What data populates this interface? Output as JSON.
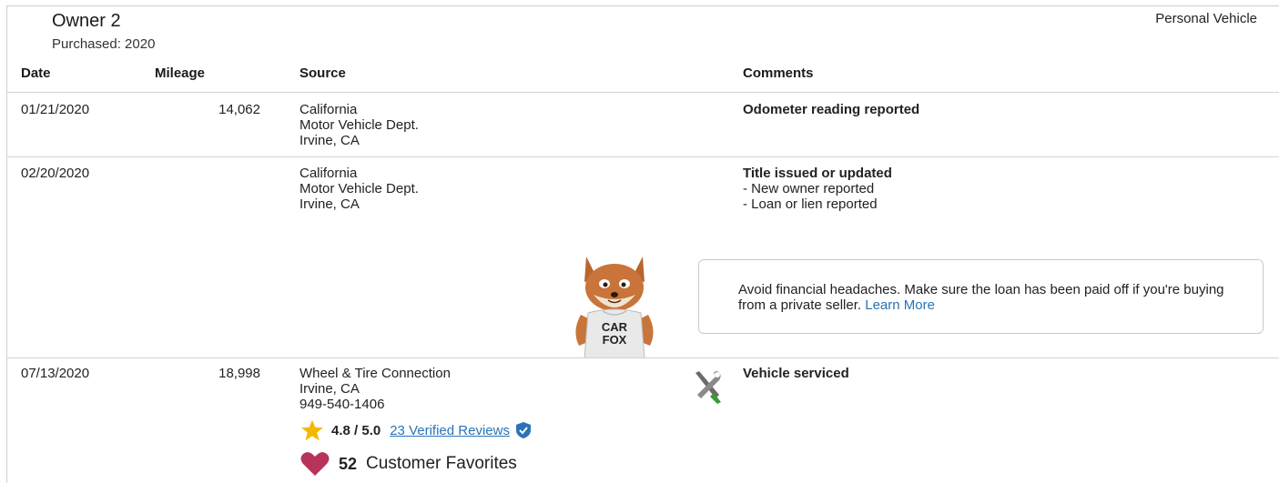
{
  "owner": {
    "title": "Owner 2",
    "purchased": "Purchased: 2020",
    "vehicle_type": "Personal Vehicle"
  },
  "table": {
    "headers": [
      "Date",
      "Mileage",
      "Source",
      "Comments"
    ],
    "rows": [
      {
        "date": "01/21/2020",
        "mileage": "14,062",
        "source": [
          "California",
          "Motor Vehicle Dept.",
          "Irvine, CA"
        ],
        "comment_title": "Odometer reading reported",
        "comment_items": []
      },
      {
        "date": "02/20/2020",
        "mileage": "",
        "source": [
          "California",
          "Motor Vehicle Dept.",
          "Irvine, CA"
        ],
        "comment_title": "Title issued or updated",
        "comment_items": [
          "- New owner reported",
          "- Loan or lien reported"
        ]
      },
      {
        "date": "07/13/2020",
        "mileage": "18,998",
        "source": [
          "Wheel & Tire Connection",
          "Irvine, CA",
          "949-540-1406"
        ],
        "comment_title": "Vehicle serviced",
        "comment_items": []
      }
    ]
  },
  "callout": {
    "text": "Avoid financial headaches. Make sure the loan has been paid off if you're buying from a private seller.",
    "link": "Learn More"
  },
  "mascot": {
    "shirt_line1": "CAR",
    "shirt_line2": "FOX"
  },
  "dealer": {
    "rating": "4.8 / 5.0",
    "reviews_link": "23 Verified Reviews",
    "favorites_count": "52",
    "favorites_label": "Customer Favorites"
  },
  "colors": {
    "link": "#2a73b8",
    "star": "#f5b800",
    "heart": "#b8335a",
    "verified": "#2a73b8"
  },
  "icons": [
    "star-icon",
    "verified-badge-icon",
    "heart-icon",
    "service-tools-icon"
  ]
}
